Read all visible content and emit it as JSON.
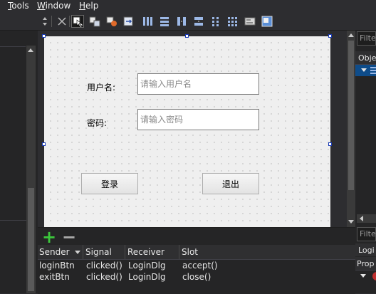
{
  "menubar": {
    "items": [
      {
        "mnemonic": "T",
        "rest": "ools"
      },
      {
        "mnemonic": "W",
        "rest": "indow"
      },
      {
        "mnemonic": "H",
        "rest": "elp"
      }
    ]
  },
  "toolbar": {
    "icons": [
      "break-layout-icon",
      "edit-widgets-icon",
      "edit-signals-slots-icon",
      "edit-buddies-icon",
      "edit-tab-order-icon",
      "layout-horizontal-icon",
      "layout-vertical-icon",
      "layout-horizontal-splitter-icon",
      "layout-vertical-splitter-icon",
      "layout-form-icon",
      "layout-grid-icon",
      "adjust-size-icon",
      "preview-icon"
    ]
  },
  "form": {
    "username_label": "用户名:",
    "username_placeholder": "请输入用户名",
    "password_label": "密码:",
    "password_placeholder": "请输入密码",
    "login_button": "登录",
    "exit_button": "退出"
  },
  "right_panel": {
    "filter_top": "Filter",
    "object_header": "Obje",
    "filter_bottom": "Filte",
    "login_row": "Logi",
    "prop_header": "Prop"
  },
  "signal_slot_editor": {
    "add_symbol": "+",
    "remove_symbol": "−",
    "columns": [
      "Sender",
      "Signal",
      "Receiver",
      "Slot"
    ],
    "rows": [
      [
        "loginBtn",
        "clicked()",
        "LoginDlg",
        "accept()"
      ],
      [
        "exitBtn",
        "clicked()",
        "LoginDlg",
        "close()"
      ]
    ]
  },
  "colors": {
    "background": "#2d2d30",
    "panel": "#252526",
    "form": "#efefef",
    "selection_handle": "#1a3cb8",
    "add_green": "#3cc83c",
    "tree_selection": "#0e4c8a"
  }
}
